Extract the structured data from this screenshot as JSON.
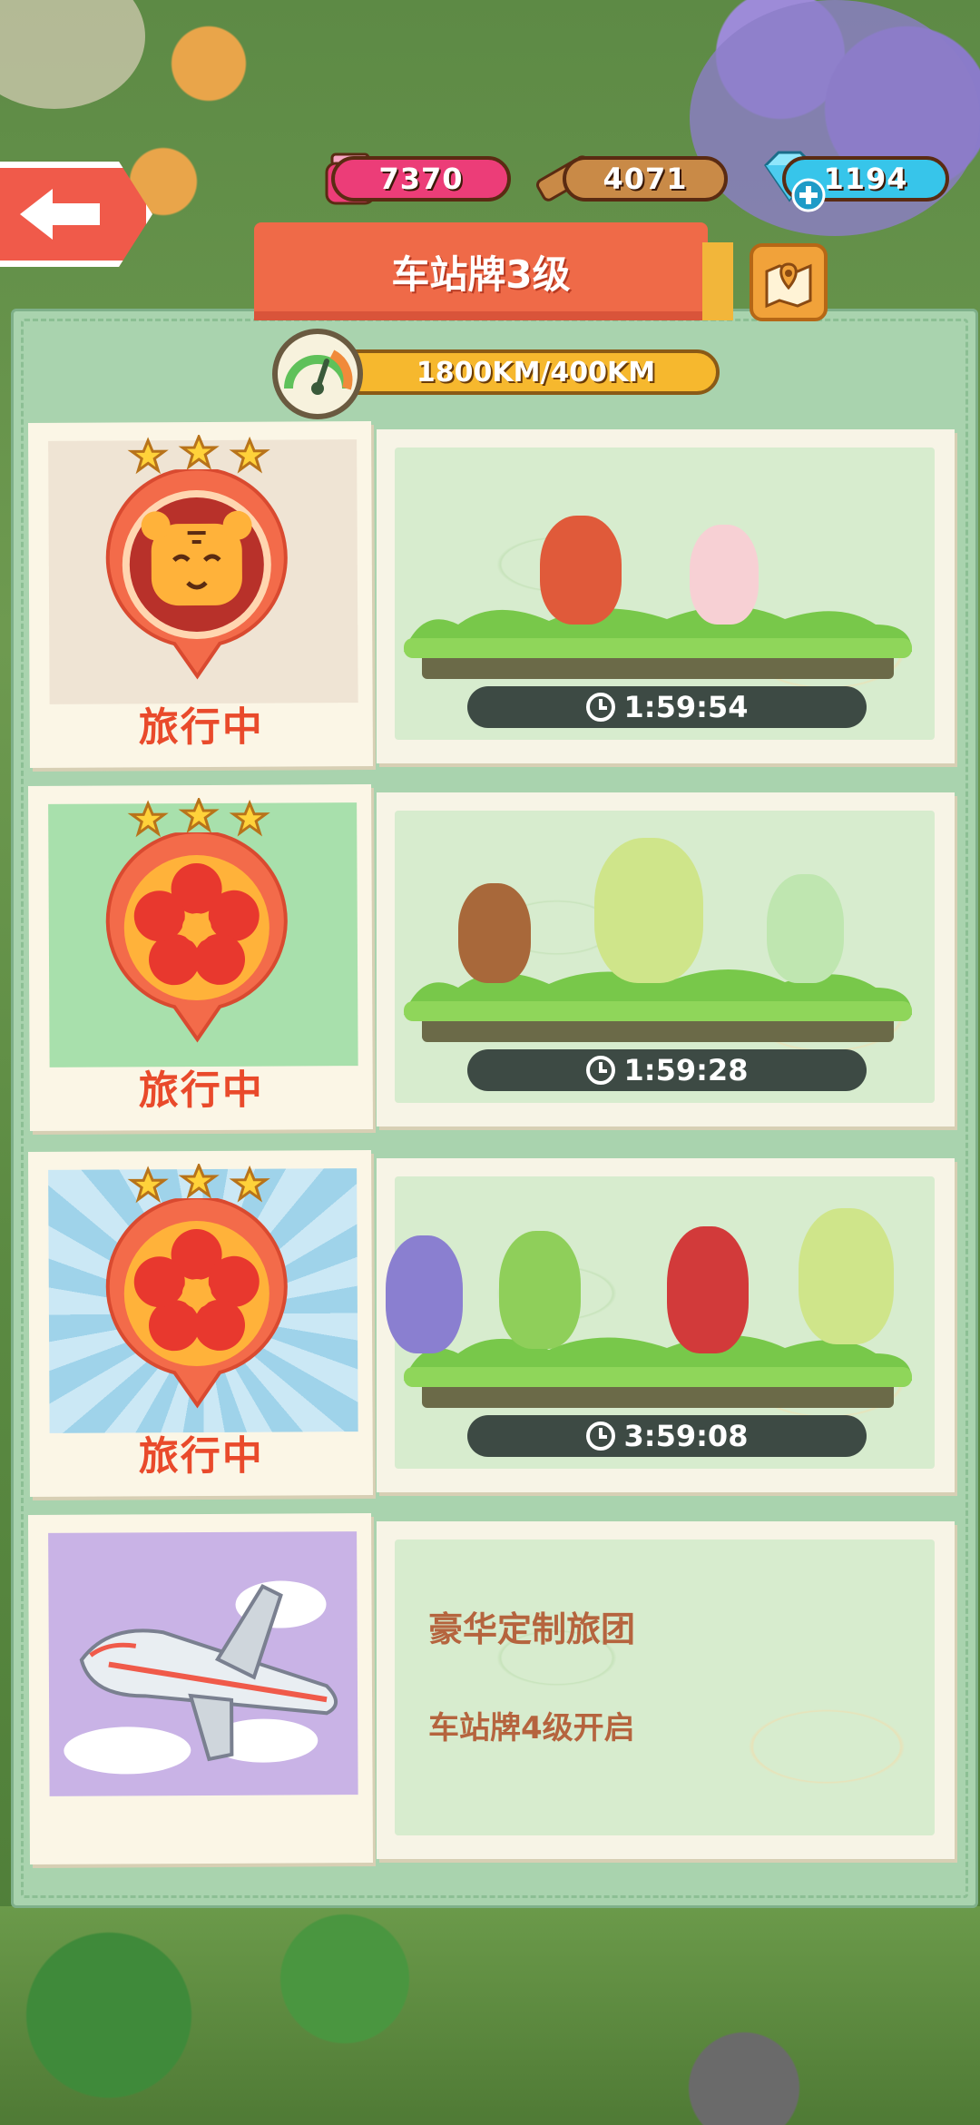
{
  "resources": {
    "ink": "7370",
    "wood": "4071",
    "gems": "1194"
  },
  "header": {
    "title": "车站牌3级"
  },
  "progress": {
    "text": "1800KM/400KM"
  },
  "groups": [
    {
      "status": "旅行中",
      "timer": "1:59:54",
      "stars": 3,
      "badge_icon": "tiger-icon"
    },
    {
      "status": "旅行中",
      "timer": "1:59:28",
      "stars": 3,
      "badge_icon": "plum-blossom-icon"
    },
    {
      "status": "旅行中",
      "timer": "3:59:08",
      "stars": 3,
      "badge_icon": "plum-blossom-icon"
    }
  ],
  "locked": {
    "title": "豪华定制旅团",
    "requirement": "车站牌4级开启",
    "icon": "airplane-icon"
  },
  "colors": {
    "accent": "#ef6a48",
    "status_red": "#e94a2b",
    "panel": "#a9d3ae"
  }
}
